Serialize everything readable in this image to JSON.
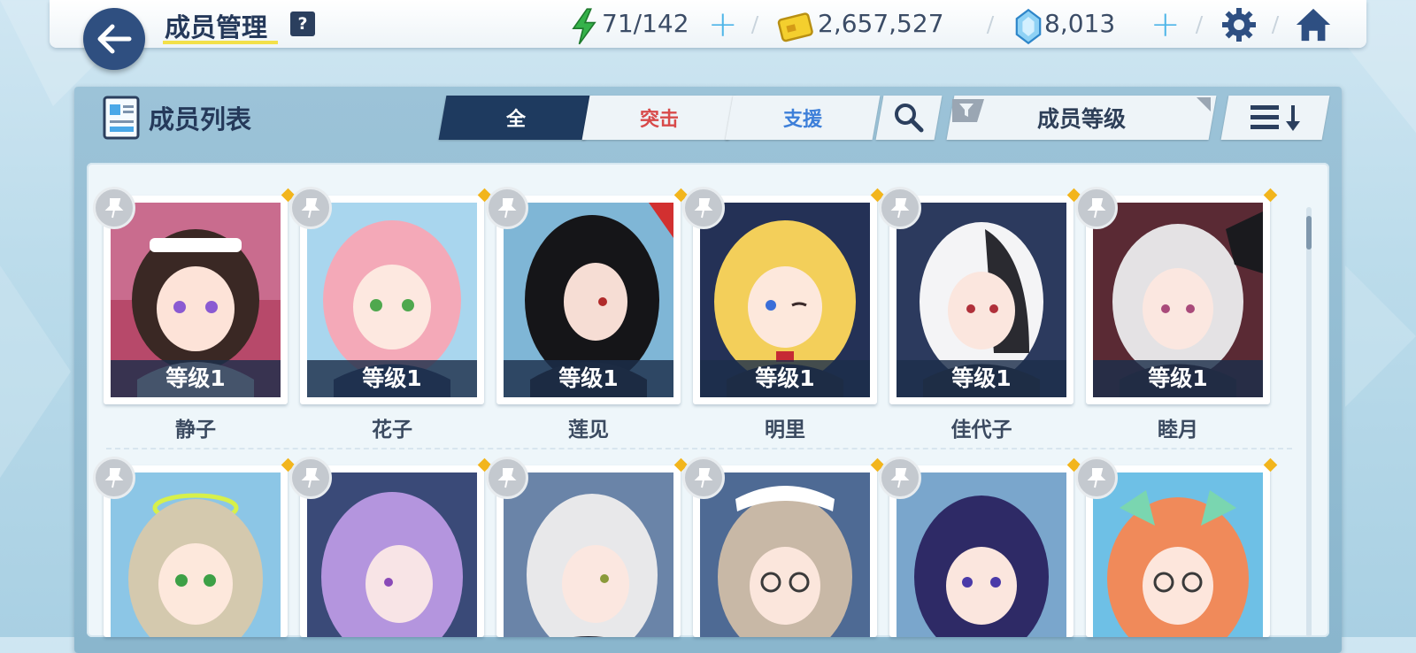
{
  "header": {
    "title": "成员管理",
    "help_label": "?",
    "stamina": "71/142",
    "credits": "2,657,527",
    "gems": "8,013",
    "plus_symbol": "+"
  },
  "icons": [
    "back-arrow-icon",
    "help-icon",
    "lightning-icon",
    "credit-card-icon",
    "gem-icon",
    "plus-icon",
    "gear-icon",
    "home-icon",
    "roster-icon",
    "search-icon",
    "filter-icon",
    "sort-order-icon",
    "pin-icon"
  ],
  "colors": {
    "navy": "#1e3a5f",
    "assault": "#d84a4a",
    "support": "#3d7fd9",
    "accent_yellow": "#f3e04a",
    "plus": "#4db5e8"
  },
  "panel": {
    "title": "成员列表",
    "tabs": [
      {
        "label": "全",
        "active": true
      },
      {
        "label": "突击",
        "active": false
      },
      {
        "label": "支援",
        "active": false
      }
    ],
    "sort_label": "成员等级"
  },
  "members_row1": [
    {
      "name": "静子",
      "level": "等级1"
    },
    {
      "name": "花子",
      "level": "等级1"
    },
    {
      "name": "莲见",
      "level": "等级1"
    },
    {
      "name": "明里",
      "level": "等级1"
    },
    {
      "name": "佳代子",
      "level": "等级1"
    },
    {
      "name": "睦月",
      "level": "等级1"
    }
  ]
}
